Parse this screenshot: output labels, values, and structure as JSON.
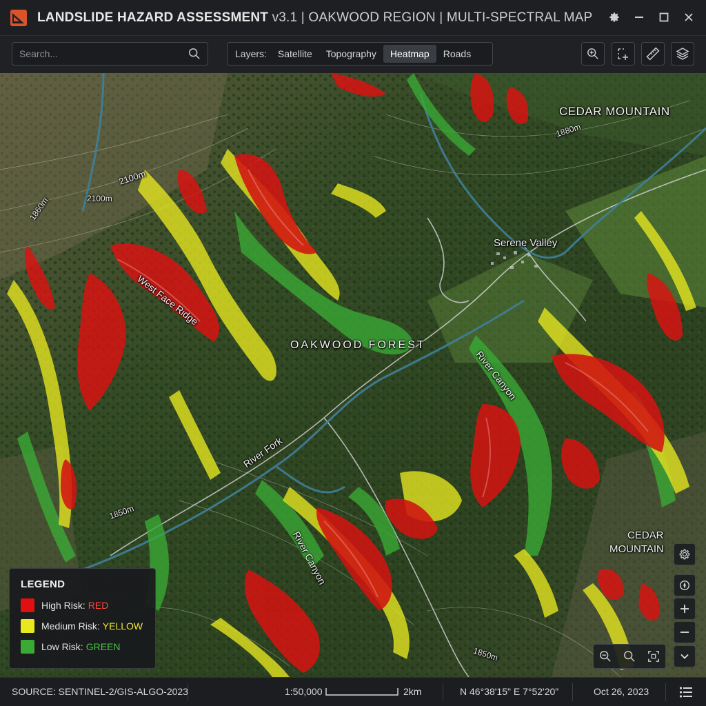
{
  "app": {
    "title_bold": "LANDSLIDE HAZARD ASSESSMENT",
    "title_rest": "v3.1 | OAKWOOD REGION | MULTI-SPECTRAL MAP"
  },
  "toolbar": {
    "search_placeholder": "Search...",
    "layers_label": "Layers:",
    "layer_tabs": [
      {
        "label": "Satellite",
        "active": false
      },
      {
        "label": "Topography",
        "active": false
      },
      {
        "label": "Heatmap",
        "active": true
      },
      {
        "label": "Roads",
        "active": false
      }
    ]
  },
  "map": {
    "labels": {
      "cedar_mountain_top": "CEDAR MOUNTAIN",
      "cedar_mountain_bottom_1": "CEDAR",
      "cedar_mountain_bottom_2": "MOUNTAIN",
      "serene_valley": "Serene Valley",
      "oakwood_forest": "OAKWOOD FOREST",
      "west_face_ridge": "West Face Ridge",
      "river_canyon_right": "River Canyon",
      "river_canyon_bottom": "River Canyon",
      "river_fork": "River Fork",
      "contour_2100_a": "2100m",
      "contour_2100_b": "2100m",
      "contour_1860": "1860m",
      "contour_1880": "1880m",
      "contour_1850_a": "1850m",
      "contour_1850_b": "1850m"
    }
  },
  "legend": {
    "title": "LEGEND",
    "items": [
      {
        "label": "High Risk:",
        "value": "RED",
        "color": "#e01010"
      },
      {
        "label": "Medium Risk:",
        "value": "YELLOW",
        "color": "#e8e820"
      },
      {
        "label": "Low Risk:",
        "value": "GREEN",
        "color": "#3aaa35"
      }
    ]
  },
  "statusbar": {
    "source": "SOURCE: SENTINEL-2/GIS-ALGO-2023",
    "scale": "1:50,000",
    "scale_distance": "2km",
    "coordinates": "N 46°38'15\" E 7°52'20\"",
    "date": "Oct 26, 2023"
  },
  "colors": {
    "high": "#e01010",
    "medium": "#e8e820",
    "low": "#3aaa35",
    "river": "#3f7f9a"
  }
}
